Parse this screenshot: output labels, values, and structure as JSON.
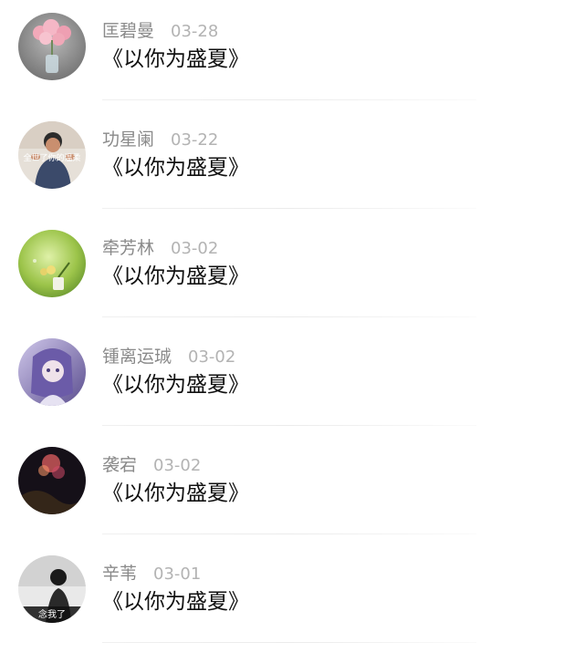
{
  "comments": [
    {
      "name": "匡碧曼",
      "date": "03-28",
      "content": "《以你为盛夏》",
      "avatar": "pink-flowers-vase"
    },
    {
      "name": "功星阑",
      "date": "03-22",
      "content": "《以你为盛夏》",
      "avatar": "person-photo",
      "avatar_caption": "全世了你的温柔"
    },
    {
      "name": "牵芳林",
      "date": "03-02",
      "content": "《以你为盛夏》",
      "avatar": "green-plant-bokeh"
    },
    {
      "name": "锺离运珹",
      "date": "03-02",
      "content": "《以你为盛夏》",
      "avatar": "anime-girl-purple"
    },
    {
      "name": "袭宕",
      "date": "03-02",
      "content": "《以你为盛夏》",
      "avatar": "night-bokeh-lights"
    },
    {
      "name": "辛苇",
      "date": "03-01",
      "content": "《以你为盛夏》",
      "avatar": "bw-girl-photo",
      "avatar_caption": "念我了"
    }
  ]
}
